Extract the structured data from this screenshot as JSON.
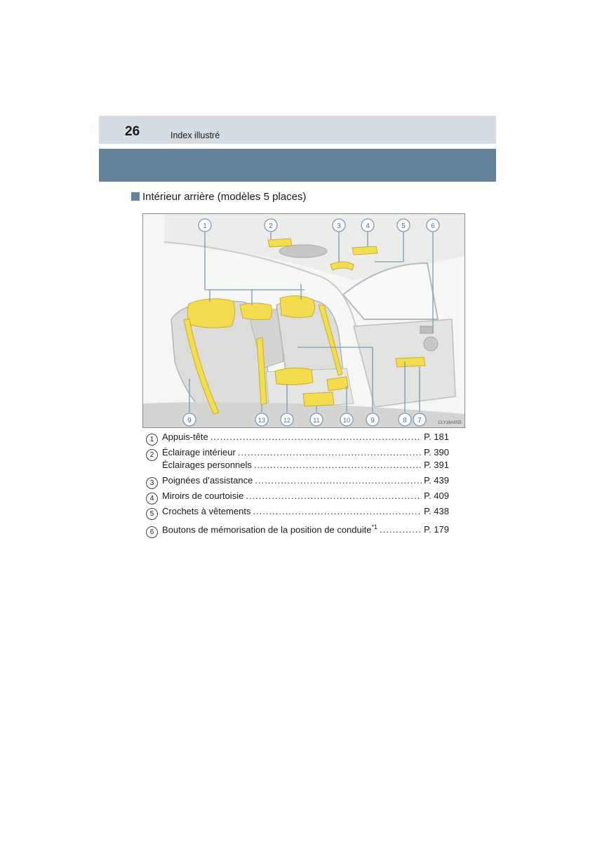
{
  "header": {
    "page_number": "26",
    "section": "Index illustré"
  },
  "section_title": "Intérieur arrière (modèles 5 places)",
  "figure": {
    "code": "CLY16AI055",
    "callouts": [
      "1",
      "2",
      "3",
      "4",
      "5",
      "6",
      "7",
      "8",
      "9",
      "10",
      "11",
      "12",
      "13",
      "9"
    ],
    "highlight_color": "#f3dc4f",
    "line_color": "#7a9ab5"
  },
  "items": [
    {
      "num": "1",
      "label": "Appuis-tête",
      "sup": "",
      "page": "P. 181"
    },
    {
      "num": "2",
      "label": "Éclairage intérieur",
      "sup": "",
      "page": "P. 390"
    },
    {
      "num": "",
      "label": "Éclairages personnels",
      "sup": "",
      "page": "P. 391"
    },
    {
      "num": "3",
      "label": "Poignées d’assistance",
      "sup": "",
      "page": "P. 439"
    },
    {
      "num": "4",
      "label": "Miroirs de courtoisie",
      "sup": "",
      "page": "P. 409"
    },
    {
      "num": "5",
      "label": "Crochets à vêtements",
      "sup": "",
      "page": "P. 438"
    },
    {
      "num": "6",
      "label": "Boutons de mémorisation de la position de conduite",
      "sup": "*1",
      "page": "P. 179"
    }
  ]
}
